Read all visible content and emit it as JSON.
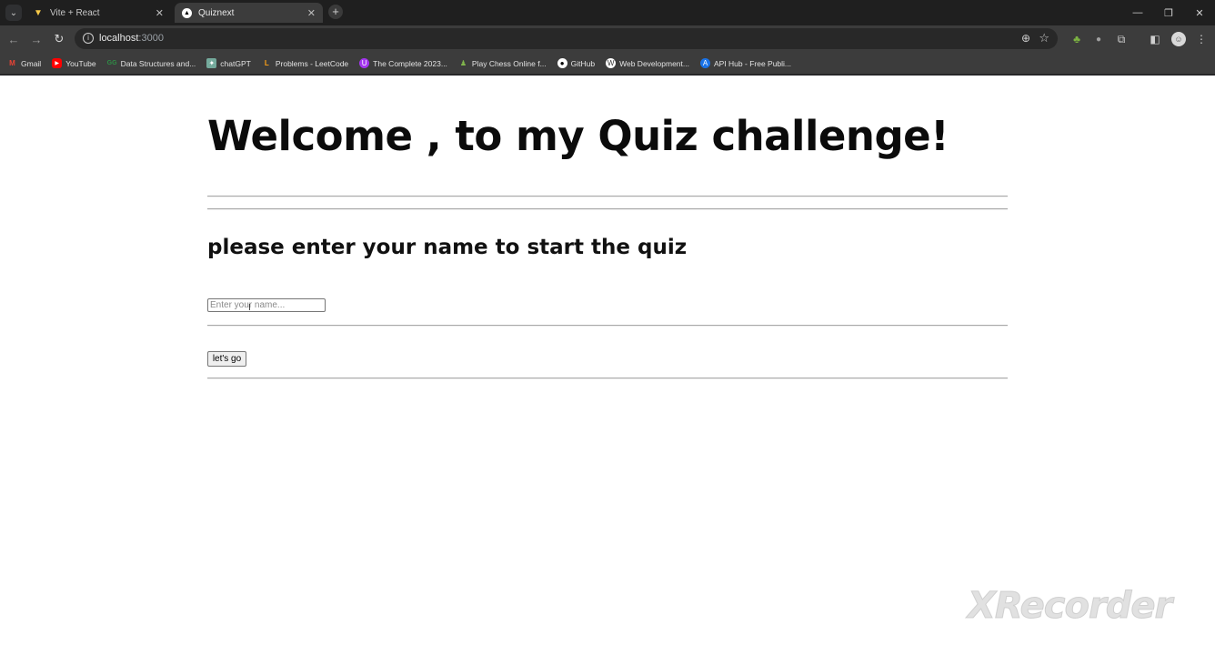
{
  "browser": {
    "tabs": [
      {
        "label": "Vite + React",
        "icon": "vite-logo-icon",
        "active": false
      },
      {
        "label": "Quiznext",
        "icon": "nextjs-logo-icon",
        "active": true
      }
    ],
    "new_tab_symbol": "+",
    "url_host": "localhost",
    "url_port": ":3000",
    "bookmarks": [
      {
        "label": "Gmail",
        "icon": "gmail-icon",
        "glyph": "M"
      },
      {
        "label": "YouTube",
        "icon": "youtube-icon",
        "glyph": "▶"
      },
      {
        "label": "Data Structures and...",
        "icon": "gfg-icon",
        "glyph": "GG"
      },
      {
        "label": "chatGPT",
        "icon": "chatgpt-icon",
        "glyph": "✦"
      },
      {
        "label": "Problems - LeetCode",
        "icon": "leetcode-icon",
        "glyph": "L"
      },
      {
        "label": "The Complete 2023...",
        "icon": "udemy-icon",
        "glyph": "U"
      },
      {
        "label": "Play Chess Online f...",
        "icon": "chess-icon",
        "glyph": "♟"
      },
      {
        "label": "GitHub",
        "icon": "github-icon",
        "glyph": "●"
      },
      {
        "label": "Web Development...",
        "icon": "web-dev-icon",
        "glyph": "W"
      },
      {
        "label": "API Hub - Free Publi...",
        "icon": "api-hub-icon",
        "glyph": "A"
      }
    ]
  },
  "page": {
    "title": "Welcome , to my Quiz challenge!",
    "subtitle": "please enter your name to start the quiz",
    "name_input": {
      "placeholder": "Enter your name...",
      "value": ""
    },
    "start_button_label": "let's go"
  },
  "watermark": "XRecorder"
}
